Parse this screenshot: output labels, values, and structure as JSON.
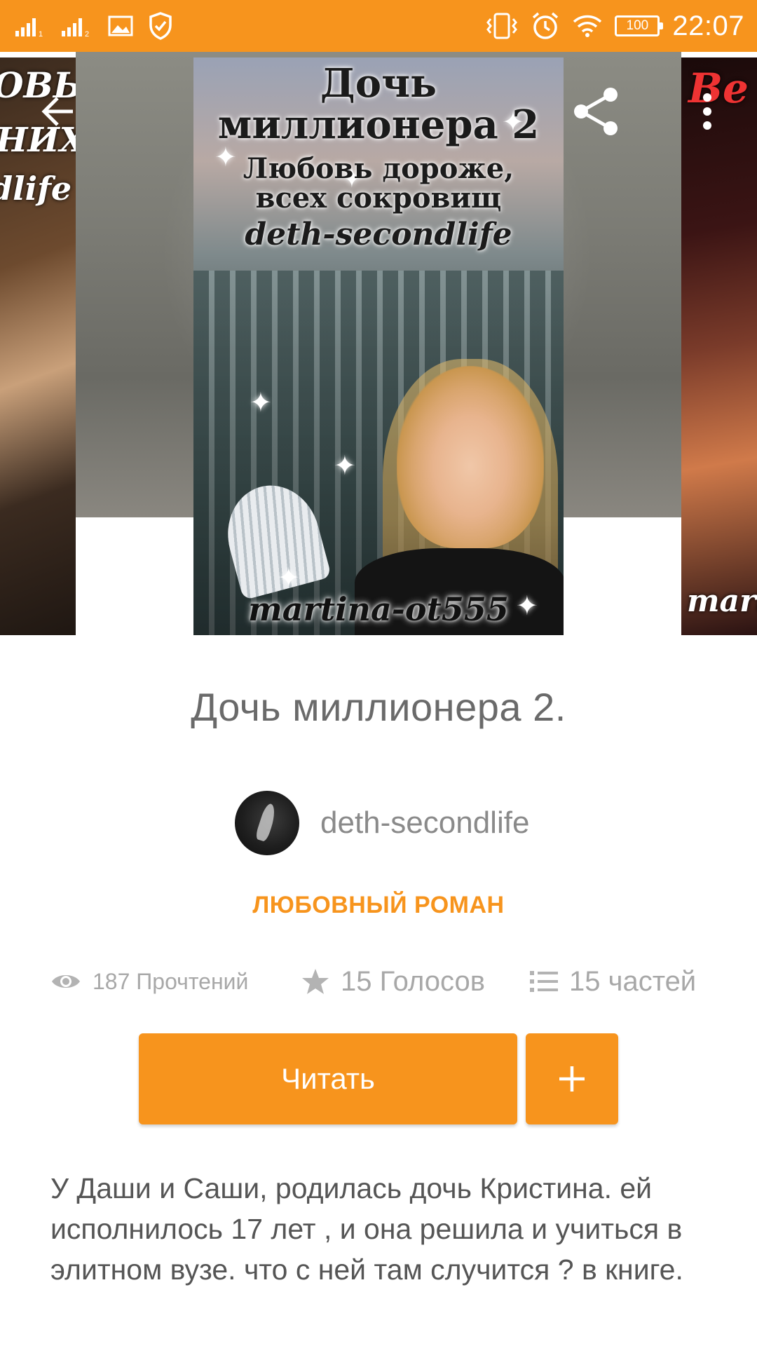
{
  "status_bar": {
    "time": "22:07",
    "battery": "100",
    "icons_left": [
      "signal-1-icon",
      "signal-2-icon",
      "image-icon",
      "shield-icon"
    ],
    "icons_right": [
      "vibrate-icon",
      "alarm-icon",
      "wifi-icon",
      "battery-icon"
    ]
  },
  "theme": {
    "accent": "#f7941d",
    "text": "#6a6a6a",
    "muted": "#a8a8a8"
  },
  "hero": {
    "cover": {
      "title_line1": "Дочь",
      "title_line2": "миллионера 2",
      "subtitle_line1": "Любовь дороже,",
      "subtitle_line2": "всех сокровищ",
      "author_sign": "deth-secondlife",
      "watermark": "martina-ot555"
    },
    "left_cover_text": [
      "ОВЬ",
      "НИХ.",
      "dlife"
    ],
    "right_cover_text": [
      "Ве",
      "marti"
    ],
    "actions": {
      "back": "back-arrow-icon",
      "share": "share-icon",
      "more": "more-vert-icon"
    }
  },
  "story": {
    "title": "Дочь миллионера 2.",
    "author": "deth-secondlife",
    "genre": "ЛЮБОВНЫЙ РОМАН",
    "stats": {
      "reads": "187 Прочтений",
      "votes": "15 Голосов",
      "parts": "15 частей"
    },
    "read_button": "Читать",
    "add_button": "+",
    "description": "У Даши и Саши, родилась дочь Кристина. ей исполнилось 17 лет , и она решила и учиться в элитном вузе. что с ней там случится ? в книге."
  }
}
